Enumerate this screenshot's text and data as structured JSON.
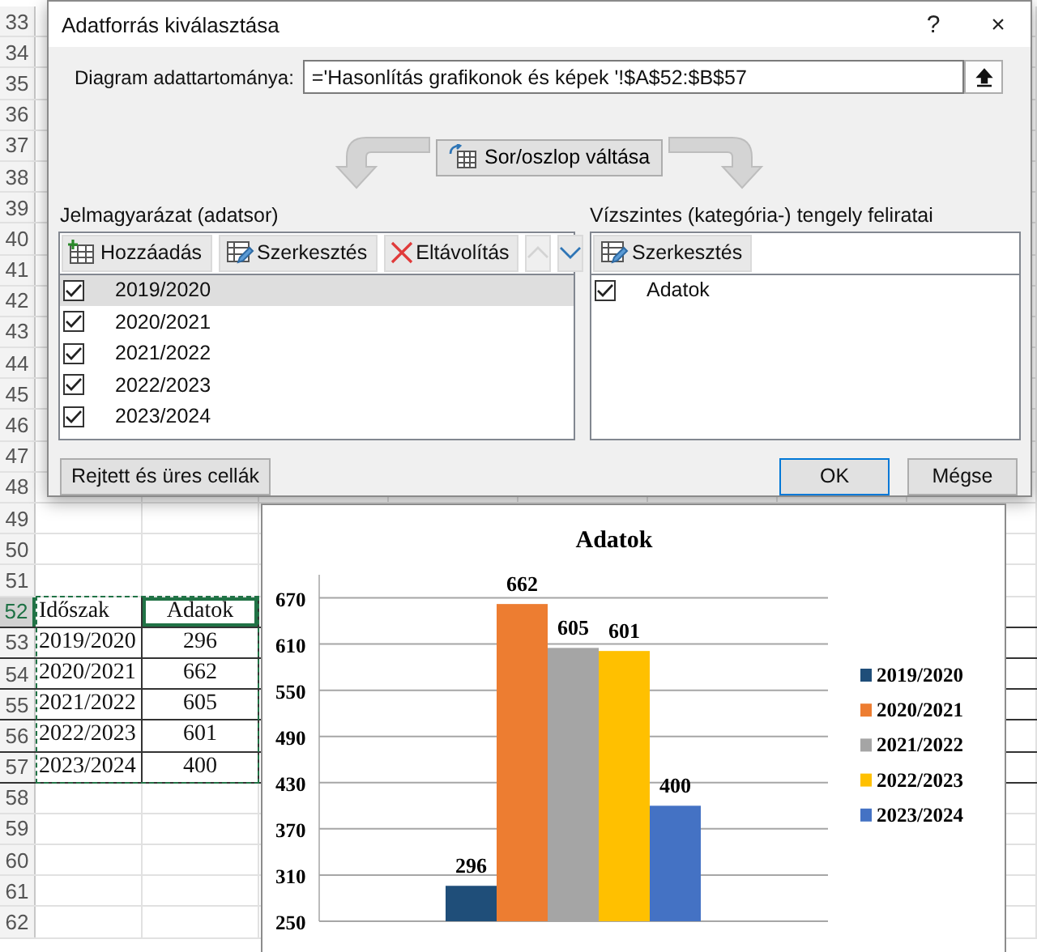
{
  "sheet": {
    "rows": [
      {
        "number": "33",
        "selected": false,
        "in_range": false
      },
      {
        "number": "34",
        "selected": false,
        "in_range": false
      },
      {
        "number": "35",
        "selected": false,
        "in_range": false
      },
      {
        "number": "36",
        "selected": false,
        "in_range": false
      },
      {
        "number": "37",
        "selected": false,
        "in_range": false
      },
      {
        "number": "38",
        "selected": false,
        "in_range": false
      },
      {
        "number": "39",
        "selected": false,
        "in_range": false
      },
      {
        "number": "40",
        "selected": false,
        "in_range": false
      },
      {
        "number": "41",
        "selected": false,
        "in_range": false
      },
      {
        "number": "42",
        "selected": false,
        "in_range": false
      },
      {
        "number": "43",
        "selected": false,
        "in_range": false
      },
      {
        "number": "44",
        "selected": false,
        "in_range": false
      },
      {
        "number": "45",
        "selected": false,
        "in_range": false
      },
      {
        "number": "46",
        "selected": false,
        "in_range": false
      },
      {
        "number": "47",
        "selected": false,
        "in_range": false
      },
      {
        "number": "48",
        "selected": false,
        "in_range": false
      },
      {
        "number": "49",
        "selected": false,
        "in_range": false
      },
      {
        "number": "50",
        "selected": false,
        "in_range": false
      },
      {
        "number": "51",
        "selected": false,
        "in_range": false
      },
      {
        "number": "52",
        "column_1": "Időszak",
        "column_2": "Adatok",
        "selected": true,
        "in_range": true
      },
      {
        "number": "53",
        "column_1": "2019/2020",
        "column_2": "296",
        "selected": false,
        "in_range": true
      },
      {
        "number": "54",
        "column_1": "2020/2021",
        "column_2": "662",
        "selected": false,
        "in_range": true
      },
      {
        "number": "55",
        "column_1": "2021/2022",
        "column_2": "605",
        "selected": false,
        "in_range": true
      },
      {
        "number": "56",
        "column_1": "2022/2023",
        "column_2": "601",
        "selected": false,
        "in_range": true
      },
      {
        "number": "57",
        "column_1": "2023/2024",
        "column_2": "400",
        "selected": false,
        "in_range": true
      },
      {
        "number": "58",
        "selected": false,
        "in_range": false
      },
      {
        "number": "59",
        "selected": false,
        "in_range": false
      },
      {
        "number": "60",
        "selected": false,
        "in_range": false
      },
      {
        "number": "61",
        "selected": false,
        "in_range": false
      },
      {
        "number": "62",
        "selected": false,
        "in_range": false
      }
    ]
  },
  "dialog": {
    "title": "Adatforrás kiválasztása",
    "help": "?",
    "close": "×",
    "range_label": "Diagram adattartománya:",
    "range_value": "='Hasonlítás grafikonok és képek '!$A$52:$B$57",
    "switch_button": "Sor/oszlop váltása",
    "legend_title": "Jelmagyarázat (adatsor)",
    "legend_toolbar": [
      {
        "kind": "add",
        "label": "Hozzáadás",
        "disabled": false
      },
      {
        "kind": "edit",
        "label": "Szerkesztés",
        "disabled": false
      },
      {
        "kind": "remove",
        "label": "Eltávolítás",
        "disabled": false
      },
      {
        "kind": "up",
        "disabled": true
      },
      {
        "kind": "down",
        "disabled": false
      }
    ],
    "legend_items": [
      {
        "label": "2019/2020",
        "checked": true,
        "selected": true
      },
      {
        "label": "2020/2021",
        "checked": true,
        "selected": false
      },
      {
        "label": "2021/2022",
        "checked": true,
        "selected": false
      },
      {
        "label": "2022/2023",
        "checked": true,
        "selected": false
      },
      {
        "label": "2023/2024",
        "checked": true,
        "selected": false
      }
    ],
    "axis_title": "Vízszintes (kategória-) tengely feliratai",
    "axis_toolbar": [
      {
        "kind": "edit",
        "label": "Szerkesztés",
        "disabled": false
      }
    ],
    "axis_items": [
      {
        "label": "Adatok",
        "checked": true,
        "selected": false
      }
    ],
    "hidden_cells_button": "Rejtett és üres cellák",
    "ok_button": "OK",
    "cancel_button": "Mégse"
  },
  "chart": {
    "chart_data": {
      "type": "bar",
      "title": "Adatok",
      "grid": true,
      "legend": true,
      "series": [
        {
          "name": "2019/2020",
          "color": "#1f4e79",
          "values": [
            296
          ]
        },
        {
          "name": "2020/2021",
          "color": "#ed7d31",
          "values": [
            662
          ]
        },
        {
          "name": "2021/2022",
          "color": "#a5a5a5",
          "values": [
            605
          ]
        },
        {
          "name": "2022/2023",
          "color": "#ffc000",
          "values": [
            601
          ]
        },
        {
          "name": "2023/2024",
          "color": "#4472c4",
          "values": [
            400
          ]
        }
      ],
      "ylim": [
        250,
        700
      ],
      "yticks": [
        250,
        310,
        370,
        430,
        490,
        550,
        610,
        670
      ],
      "value_labels": [
        "296",
        "662",
        "605",
        "601",
        "400"
      ]
    }
  }
}
